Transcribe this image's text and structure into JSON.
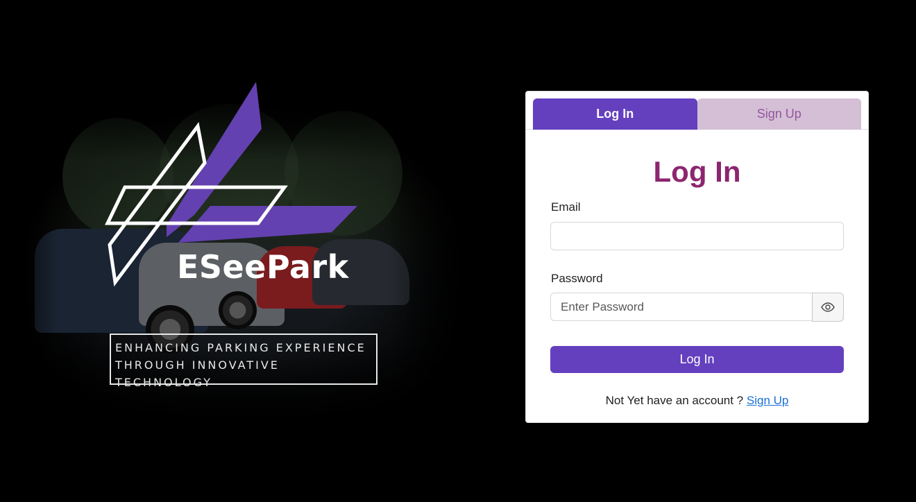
{
  "brand": {
    "name": "ESeePark",
    "tagline_line1": "ENHANCING PARKING EXPERIENCE",
    "tagline_line2": "THROUGH INNOVATIVE TECHNOLOGY"
  },
  "tabs": [
    {
      "label": "Log In",
      "active": true
    },
    {
      "label": "Sign Up",
      "active": false
    }
  ],
  "form": {
    "title": "Log In",
    "email_label": "Email",
    "email_value": "",
    "email_placeholder": "",
    "password_label": "Password",
    "password_value": "",
    "password_placeholder": "Enter Password",
    "toggle_icon": "eye-icon",
    "submit_label": "Log In",
    "footer_text": "Not Yet have an account ?",
    "footer_link": "Sign Up"
  },
  "colors": {
    "accent": "#6440bf",
    "title": "#8b266f",
    "inactive_tab_bg": "#d4bfd6",
    "inactive_tab_text": "#94549c",
    "link": "#1a6fd6"
  }
}
